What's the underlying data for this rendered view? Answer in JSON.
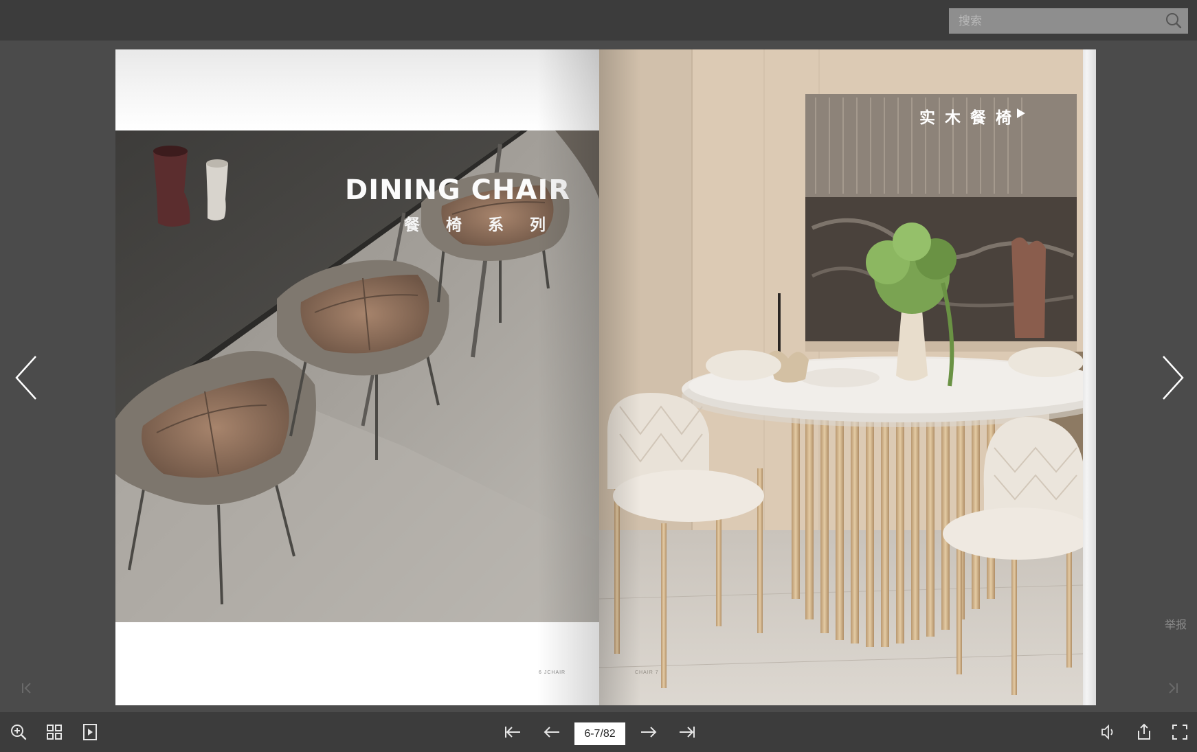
{
  "search": {
    "placeholder": "搜索"
  },
  "book": {
    "left_page": {
      "title_en": "DINING CHAIR",
      "title_cn": "餐椅系列",
      "folio": "6 JCHAIR"
    },
    "right_page": {
      "tag_cn": "实木餐椅",
      "folio": "CHAIR 7"
    }
  },
  "side": {
    "report_label": "举报"
  },
  "toolbar": {
    "page_indicator": "6-7/82",
    "left_buttons": [
      "zoom-in-icon",
      "thumbnails-icon",
      "autoplay-icon"
    ],
    "center_buttons": [
      "first-page-icon",
      "previous-page-icon",
      "next-page-icon",
      "last-page-icon"
    ],
    "right_buttons": [
      "sound-icon",
      "share-icon",
      "fullscreen-icon"
    ]
  },
  "colors": {
    "background": "#4b4b4b",
    "bar": "#3c3c3c",
    "search_field": "#8e8e8e",
    "page_white": "#ffffff"
  }
}
